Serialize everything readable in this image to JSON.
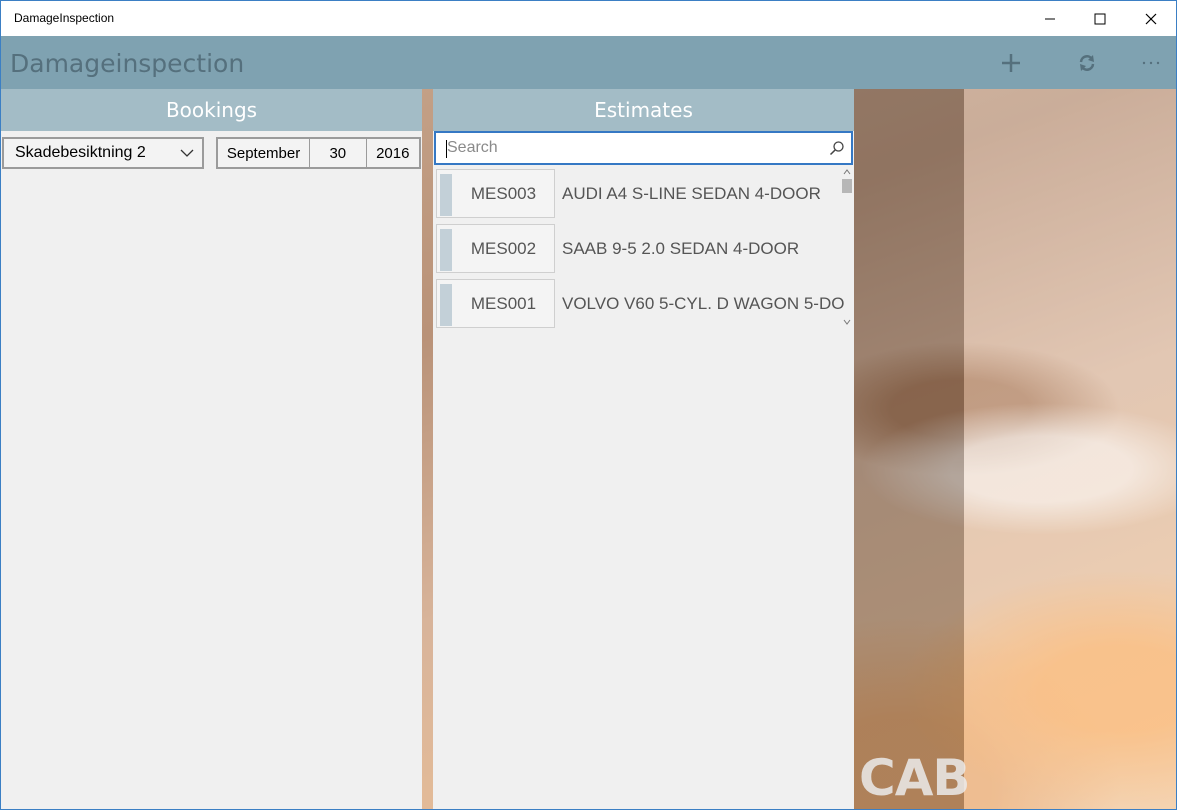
{
  "window": {
    "title": "DamageInspection",
    "controls": [
      "minimize-icon",
      "maximize-icon",
      "close-icon"
    ]
  },
  "header": {
    "app_title": "Damageinspection",
    "actions": [
      "add-icon",
      "refresh-icon",
      "more-icon"
    ]
  },
  "bookings": {
    "title": "Bookings",
    "dropdown_value": "Skadebesiktning 2",
    "date": {
      "month": "September",
      "day": "30",
      "year": "2016"
    }
  },
  "estimates": {
    "title": "Estimates",
    "search_placeholder": "Search",
    "items": [
      {
        "code": "MES003",
        "description": "AUDI A4 S-LINE SEDAN 4-DOOR"
      },
      {
        "code": "MES002",
        "description": "SAAB 9-5 2.0 SEDAN 4-DOOR"
      },
      {
        "code": "MES001",
        "description": "VOLVO V60 5-CYL. D WAGON 5-DO"
      }
    ]
  },
  "branding": {
    "logo_text": "CAB"
  },
  "colors": {
    "header_bg": "#7fa2b1",
    "panel_header_bg": "#a3bcc6",
    "accent_blue": "#3578c4"
  }
}
